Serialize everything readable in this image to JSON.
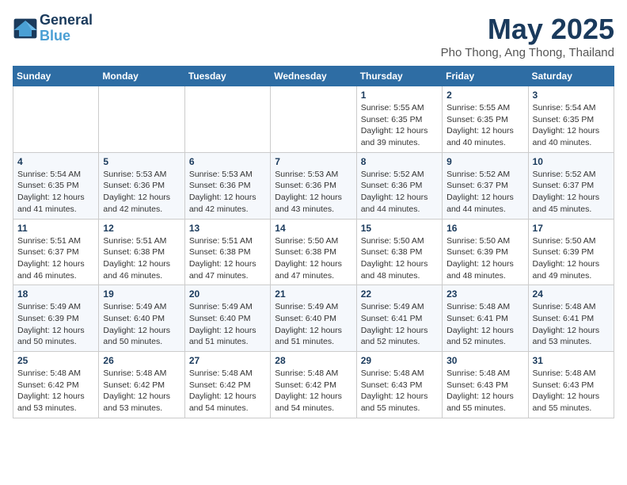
{
  "header": {
    "logo_line1": "General",
    "logo_line2": "Blue",
    "month": "May 2025",
    "location": "Pho Thong, Ang Thong, Thailand"
  },
  "days_of_week": [
    "Sunday",
    "Monday",
    "Tuesday",
    "Wednesday",
    "Thursday",
    "Friday",
    "Saturday"
  ],
  "weeks": [
    [
      {
        "day": "",
        "info": ""
      },
      {
        "day": "",
        "info": ""
      },
      {
        "day": "",
        "info": ""
      },
      {
        "day": "",
        "info": ""
      },
      {
        "day": "1",
        "info": "Sunrise: 5:55 AM\nSunset: 6:35 PM\nDaylight: 12 hours\nand 39 minutes."
      },
      {
        "day": "2",
        "info": "Sunrise: 5:55 AM\nSunset: 6:35 PM\nDaylight: 12 hours\nand 40 minutes."
      },
      {
        "day": "3",
        "info": "Sunrise: 5:54 AM\nSunset: 6:35 PM\nDaylight: 12 hours\nand 40 minutes."
      }
    ],
    [
      {
        "day": "4",
        "info": "Sunrise: 5:54 AM\nSunset: 6:35 PM\nDaylight: 12 hours\nand 41 minutes."
      },
      {
        "day": "5",
        "info": "Sunrise: 5:53 AM\nSunset: 6:36 PM\nDaylight: 12 hours\nand 42 minutes."
      },
      {
        "day": "6",
        "info": "Sunrise: 5:53 AM\nSunset: 6:36 PM\nDaylight: 12 hours\nand 42 minutes."
      },
      {
        "day": "7",
        "info": "Sunrise: 5:53 AM\nSunset: 6:36 PM\nDaylight: 12 hours\nand 43 minutes."
      },
      {
        "day": "8",
        "info": "Sunrise: 5:52 AM\nSunset: 6:36 PM\nDaylight: 12 hours\nand 44 minutes."
      },
      {
        "day": "9",
        "info": "Sunrise: 5:52 AM\nSunset: 6:37 PM\nDaylight: 12 hours\nand 44 minutes."
      },
      {
        "day": "10",
        "info": "Sunrise: 5:52 AM\nSunset: 6:37 PM\nDaylight: 12 hours\nand 45 minutes."
      }
    ],
    [
      {
        "day": "11",
        "info": "Sunrise: 5:51 AM\nSunset: 6:37 PM\nDaylight: 12 hours\nand 46 minutes."
      },
      {
        "day": "12",
        "info": "Sunrise: 5:51 AM\nSunset: 6:38 PM\nDaylight: 12 hours\nand 46 minutes."
      },
      {
        "day": "13",
        "info": "Sunrise: 5:51 AM\nSunset: 6:38 PM\nDaylight: 12 hours\nand 47 minutes."
      },
      {
        "day": "14",
        "info": "Sunrise: 5:50 AM\nSunset: 6:38 PM\nDaylight: 12 hours\nand 47 minutes."
      },
      {
        "day": "15",
        "info": "Sunrise: 5:50 AM\nSunset: 6:38 PM\nDaylight: 12 hours\nand 48 minutes."
      },
      {
        "day": "16",
        "info": "Sunrise: 5:50 AM\nSunset: 6:39 PM\nDaylight: 12 hours\nand 48 minutes."
      },
      {
        "day": "17",
        "info": "Sunrise: 5:50 AM\nSunset: 6:39 PM\nDaylight: 12 hours\nand 49 minutes."
      }
    ],
    [
      {
        "day": "18",
        "info": "Sunrise: 5:49 AM\nSunset: 6:39 PM\nDaylight: 12 hours\nand 50 minutes."
      },
      {
        "day": "19",
        "info": "Sunrise: 5:49 AM\nSunset: 6:40 PM\nDaylight: 12 hours\nand 50 minutes."
      },
      {
        "day": "20",
        "info": "Sunrise: 5:49 AM\nSunset: 6:40 PM\nDaylight: 12 hours\nand 51 minutes."
      },
      {
        "day": "21",
        "info": "Sunrise: 5:49 AM\nSunset: 6:40 PM\nDaylight: 12 hours\nand 51 minutes."
      },
      {
        "day": "22",
        "info": "Sunrise: 5:49 AM\nSunset: 6:41 PM\nDaylight: 12 hours\nand 52 minutes."
      },
      {
        "day": "23",
        "info": "Sunrise: 5:48 AM\nSunset: 6:41 PM\nDaylight: 12 hours\nand 52 minutes."
      },
      {
        "day": "24",
        "info": "Sunrise: 5:48 AM\nSunset: 6:41 PM\nDaylight: 12 hours\nand 53 minutes."
      }
    ],
    [
      {
        "day": "25",
        "info": "Sunrise: 5:48 AM\nSunset: 6:42 PM\nDaylight: 12 hours\nand 53 minutes."
      },
      {
        "day": "26",
        "info": "Sunrise: 5:48 AM\nSunset: 6:42 PM\nDaylight: 12 hours\nand 53 minutes."
      },
      {
        "day": "27",
        "info": "Sunrise: 5:48 AM\nSunset: 6:42 PM\nDaylight: 12 hours\nand 54 minutes."
      },
      {
        "day": "28",
        "info": "Sunrise: 5:48 AM\nSunset: 6:42 PM\nDaylight: 12 hours\nand 54 minutes."
      },
      {
        "day": "29",
        "info": "Sunrise: 5:48 AM\nSunset: 6:43 PM\nDaylight: 12 hours\nand 55 minutes."
      },
      {
        "day": "30",
        "info": "Sunrise: 5:48 AM\nSunset: 6:43 PM\nDaylight: 12 hours\nand 55 minutes."
      },
      {
        "day": "31",
        "info": "Sunrise: 5:48 AM\nSunset: 6:43 PM\nDaylight: 12 hours\nand 55 minutes."
      }
    ]
  ]
}
